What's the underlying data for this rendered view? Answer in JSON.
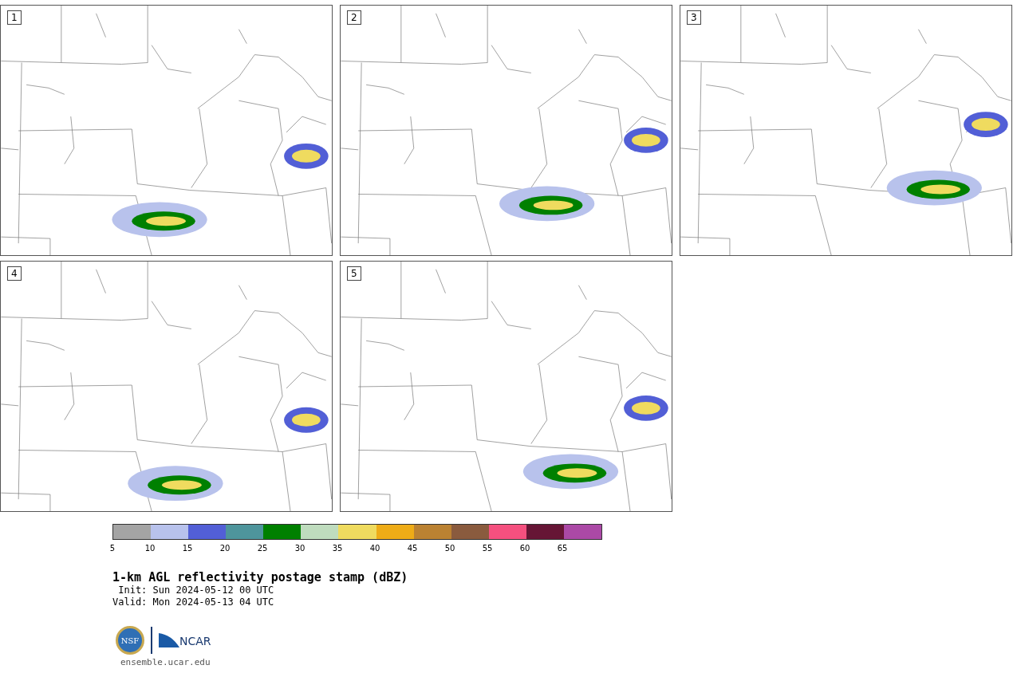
{
  "panels": [
    {
      "label": "1"
    },
    {
      "label": "2"
    },
    {
      "label": "3"
    },
    {
      "label": "4"
    },
    {
      "label": "5"
    }
  ],
  "colorbar": {
    "segments": [
      {
        "color": "#a4a4a4",
        "label": "5"
      },
      {
        "color": "#b8c2ec",
        "label": "10"
      },
      {
        "color": "#525fd6",
        "label": "15"
      },
      {
        "color": "#4e959c",
        "label": "20"
      },
      {
        "color": "#008000",
        "label": "25"
      },
      {
        "color": "#bfdcbe",
        "label": "30"
      },
      {
        "color": "#efdb5f",
        "label": "35"
      },
      {
        "color": "#eeac17",
        "label": "40"
      },
      {
        "color": "#bb8232",
        "label": "45"
      },
      {
        "color": "#8a5b3e",
        "label": "50"
      },
      {
        "color": "#f5507f",
        "label": "55"
      },
      {
        "color": "#661535",
        "label": "60"
      },
      {
        "color": "#ab49a6",
        "label": "65"
      }
    ]
  },
  "title": "1-km AGL reflectivity postage stamp (dBZ)",
  "init": " Init: Sun 2024-05-12 00 UTC",
  "valid": "Valid: Mon 2024-05-13 04 UTC",
  "logo": {
    "nsf": "NSF",
    "ncar": "NCAR"
  },
  "url": "ensemble.ucar.edu"
}
